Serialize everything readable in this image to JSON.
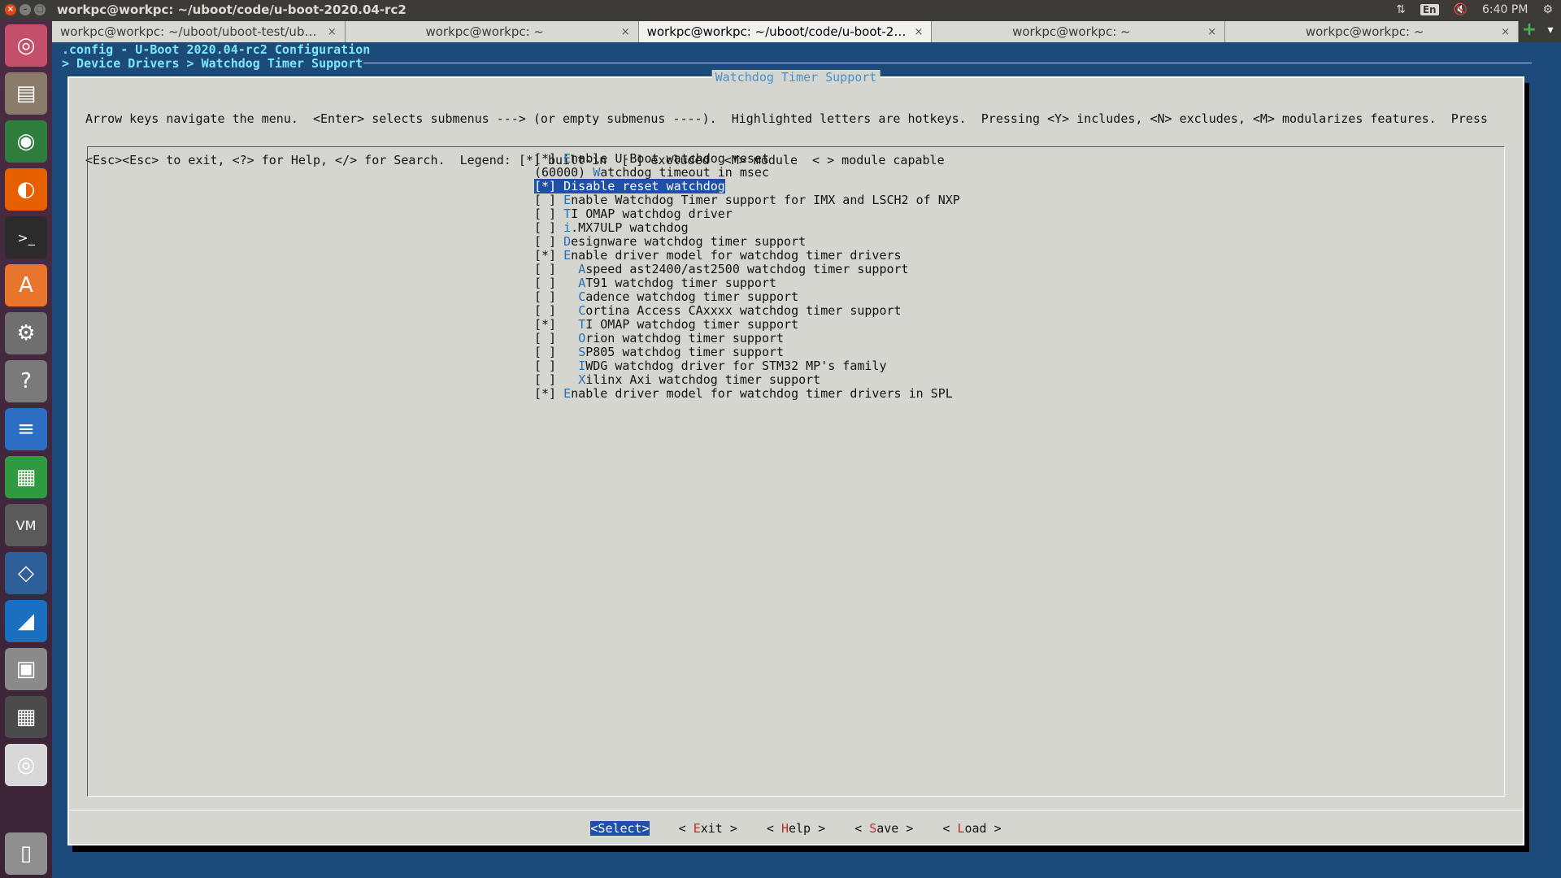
{
  "window": {
    "title": "workpc@workpc: ~/uboot/code/u-boot-2020.04-rc2",
    "buttons": [
      "×",
      "–",
      "□"
    ]
  },
  "indicators": {
    "network": "⇅",
    "keyboard": "En",
    "volume": "🔇",
    "time": "6:40 PM",
    "settings": "⚙"
  },
  "tabs": [
    {
      "label": "workpc@workpc: ~/uboot/uboot-test/uboot...",
      "active": false
    },
    {
      "label": "workpc@workpc: ~",
      "active": false
    },
    {
      "label": "workpc@workpc: ~/uboot/code/u-boot-2020...",
      "active": true
    },
    {
      "label": "workpc@workpc: ~",
      "active": false
    },
    {
      "label": "workpc@workpc: ~",
      "active": false
    }
  ],
  "tab_close": "×",
  "tab_add": "+",
  "tab_menu": "▾",
  "terminal": {
    "config_line": ".config - U-Boot 2020.04-rc2 Configuration",
    "breadcrumb": "> Device Drivers > Watchdog Timer Support"
  },
  "dialog": {
    "title": "Watchdog Timer Support",
    "help_line1": "Arrow keys navigate the menu.  <Enter> selects submenus ---> (or empty submenus ----).  Highlighted letters are hotkeys.  Pressing <Y> includes, <N> excludes, <M> modularizes features.  Press",
    "help_line2": "<Esc><Esc> to exit, <?> for Help, </> for Search.  Legend: [*] built-in  [ ] excluded  <M> module  < > module capable"
  },
  "menu_items": [
    {
      "prefix": "[*] ",
      "hot": "E",
      "rest": "nable U-Boot watchdog reset",
      "selected": false
    },
    {
      "prefix": "(60000) ",
      "hot": "W",
      "rest": "atchdog timeout in msec",
      "selected": false
    },
    {
      "prefix": "[*] ",
      "hot": "D",
      "rest": "isable reset watchdog",
      "selected": true
    },
    {
      "prefix": "[ ] ",
      "hot": "E",
      "rest": "nable Watchdog Timer support for IMX and LSCH2 of NXP",
      "selected": false
    },
    {
      "prefix": "[ ] ",
      "hot": "T",
      "rest": "I OMAP watchdog driver",
      "selected": false
    },
    {
      "prefix": "[ ] ",
      "hot": "i",
      "rest": ".MX7ULP watchdog",
      "selected": false
    },
    {
      "prefix": "[ ] ",
      "hot": "D",
      "rest": "esignware watchdog timer support",
      "selected": false
    },
    {
      "prefix": "[*] ",
      "hot": "E",
      "rest": "nable driver model for watchdog timer drivers",
      "selected": false
    },
    {
      "prefix": "[ ]   ",
      "hot": "A",
      "rest": "speed ast2400/ast2500 watchdog timer support",
      "selected": false
    },
    {
      "prefix": "[ ]   ",
      "hot": "A",
      "rest": "T91 watchdog timer support",
      "selected": false
    },
    {
      "prefix": "[ ]   ",
      "hot": "C",
      "rest": "adence watchdog timer support",
      "selected": false
    },
    {
      "prefix": "[ ]   ",
      "hot": "C",
      "rest": "ortina Access CAxxxx watchdog timer support",
      "selected": false
    },
    {
      "prefix": "[*]   ",
      "hot": "T",
      "rest": "I OMAP watchdog timer support",
      "selected": false
    },
    {
      "prefix": "[ ]   ",
      "hot": "O",
      "rest": "rion watchdog timer support",
      "selected": false
    },
    {
      "prefix": "[ ]   ",
      "hot": "S",
      "rest": "P805 watchdog timer support",
      "selected": false
    },
    {
      "prefix": "[ ]   ",
      "hot": "I",
      "rest": "WDG watchdog driver for STM32 MP's family",
      "selected": false
    },
    {
      "prefix": "[ ]   ",
      "hot": "X",
      "rest": "ilinx Axi watchdog timer support",
      "selected": false
    },
    {
      "prefix": "[*] ",
      "hot": "E",
      "rest": "nable driver model for watchdog timer drivers in SPL",
      "selected": false
    }
  ],
  "bottom_buttons": [
    {
      "pre": "<",
      "hot": "S",
      "rest": "elect>",
      "active": true,
      "name": "select-button"
    },
    {
      "pre": "< ",
      "hot": "E",
      "rest": "xit >",
      "active": false,
      "name": "exit-button"
    },
    {
      "pre": "< ",
      "hot": "H",
      "rest": "elp >",
      "active": false,
      "name": "help-button"
    },
    {
      "pre": "< ",
      "hot": "S",
      "rest": "ave >",
      "active": false,
      "name": "save-button"
    },
    {
      "pre": "< ",
      "hot": "L",
      "rest": "oad >",
      "active": false,
      "name": "load-button"
    }
  ],
  "launcher_icons": [
    {
      "name": "ubuntu-logo-icon",
      "glyph": "◎",
      "color": "#c44f6b"
    },
    {
      "name": "files-icon",
      "glyph": "▤",
      "color": "#8a7b6b"
    },
    {
      "name": "chrome-icon",
      "glyph": "◉",
      "color": "#2f7d3c"
    },
    {
      "name": "firefox-icon",
      "glyph": "◐",
      "color": "#e66000"
    },
    {
      "name": "terminal-icon",
      "glyph": ">_",
      "color": "#2b2b2b"
    },
    {
      "name": "software-center-icon",
      "glyph": "A",
      "color": "#e8752b"
    },
    {
      "name": "system-settings-icon",
      "glyph": "⚙",
      "color": "#6f6f6f"
    },
    {
      "name": "help-icon",
      "glyph": "?",
      "color": "#7a7a7a"
    },
    {
      "name": "writer-icon",
      "glyph": "≡",
      "color": "#2a6fc4"
    },
    {
      "name": "calc-icon",
      "glyph": "▦",
      "color": "#2f9a3f"
    },
    {
      "name": "vm-icon",
      "glyph": "VM",
      "color": "#5a5a5a"
    },
    {
      "name": "virtualbox-icon",
      "glyph": "◇",
      "color": "#2d5f9a"
    },
    {
      "name": "wireshark-icon",
      "glyph": "◢",
      "color": "#1b6fc0"
    },
    {
      "name": "cube-icon",
      "glyph": "▣",
      "color": "#8a8a8a"
    },
    {
      "name": "calculator-icon",
      "glyph": "▦",
      "color": "#4a4a4a"
    },
    {
      "name": "dvd-icon",
      "glyph": "◎",
      "color": "#d8d8d8"
    },
    {
      "name": "trash-icon",
      "glyph": "▯",
      "color": "#8f8f8f"
    }
  ]
}
